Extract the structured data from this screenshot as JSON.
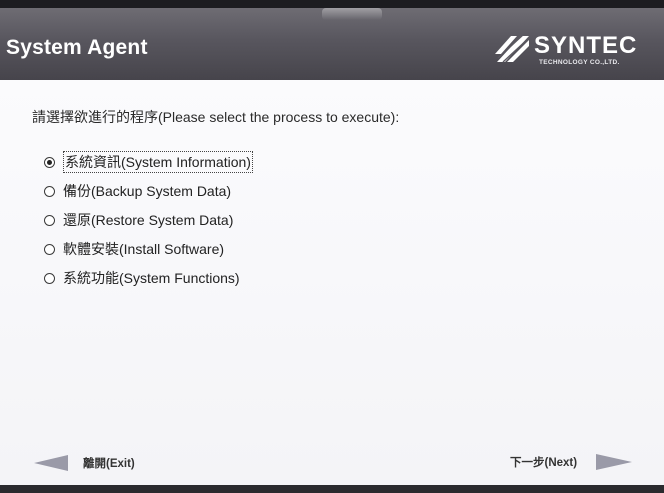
{
  "header": {
    "title": "System Agent",
    "logo": {
      "name": "SYNTEC",
      "tagline": "TECHNOLOGY CO.,LTD."
    }
  },
  "main": {
    "prompt": "請選擇欲進行的程序(Please select the process to execute):",
    "options": [
      {
        "label": "系統資訊(System Information)",
        "selected": true
      },
      {
        "label": "備份(Backup System Data)",
        "selected": false
      },
      {
        "label": "還原(Restore System Data)",
        "selected": false
      },
      {
        "label": "軟體安裝(Install Software)",
        "selected": false
      },
      {
        "label": "系統功能(System Functions)",
        "selected": false
      }
    ]
  },
  "footer": {
    "exit_label": "離開(Exit)",
    "next_label": "下一步(Next)"
  },
  "colors": {
    "header_bg": "#58565e",
    "content_bg": "#f8f8fa",
    "arrow": "#9a9aa8"
  }
}
